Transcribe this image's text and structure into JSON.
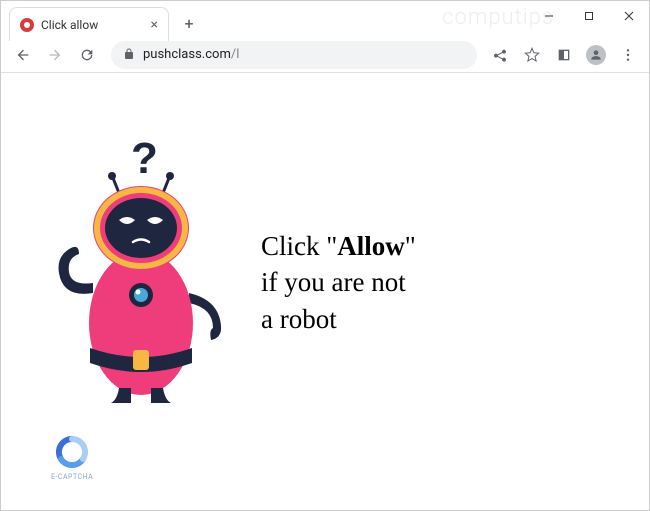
{
  "window": {
    "watermark": "computips"
  },
  "tab": {
    "title": "Click allow"
  },
  "address": {
    "host": "pushclass.com",
    "path": "/l"
  },
  "page": {
    "message_prefix": "Click \"",
    "message_bold": "Allow",
    "message_suffix": "\"",
    "message_line2": "if you are not",
    "message_line3": "a robot",
    "captcha_label": "E-CAPTCHA"
  },
  "icons": {
    "question_mark": "?",
    "close": "×",
    "plus": "+"
  }
}
